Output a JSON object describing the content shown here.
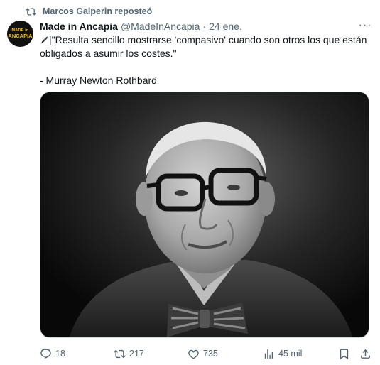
{
  "repost": {
    "text": "Marcos Galperin reposteó",
    "icon": "repost-icon"
  },
  "author": {
    "avatar_line1": "MADE in",
    "avatar_line2": "ANCAPIA",
    "name": "Made in Ancapia",
    "handle": "@MadeInAncapia",
    "separator": "·",
    "date": "24 ene."
  },
  "more_label": "···",
  "post": {
    "line1": "|\"Resulta sencillo mostrarse 'compasivo' cuando son otros los que están",
    "line2": "obligados a asumir los costes.\"",
    "line3": "- Murray Newton Rothbard"
  },
  "media": {
    "type": "black-and-white portrait photo"
  },
  "actions": {
    "replies": "18",
    "reposts": "217",
    "likes": "735",
    "views": "45 mil"
  },
  "colors": {
    "text": "#0f1419",
    "secondary": "#536471",
    "border": "#cfd9de"
  }
}
